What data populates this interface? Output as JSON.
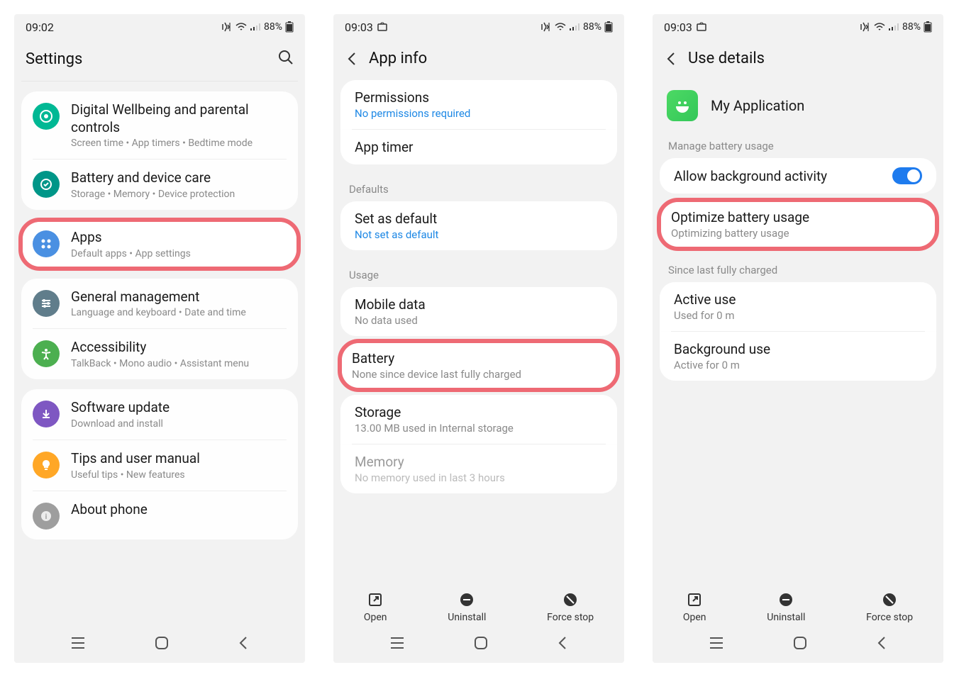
{
  "status": {
    "time1": "09:02",
    "time2": "09:03",
    "battery": "88%"
  },
  "screen1": {
    "title": "Settings",
    "items": {
      "wellbeing": {
        "title": "Digital Wellbeing and parental controls",
        "sub": "Screen time  •  App timers  •  Bedtime mode"
      },
      "battery": {
        "title": "Battery and device care",
        "sub": "Storage  •  Memory  •  Device protection"
      },
      "apps": {
        "title": "Apps",
        "sub": "Default apps  •  App settings"
      },
      "general": {
        "title": "General management",
        "sub": "Language and keyboard  •  Date and time"
      },
      "accessibility": {
        "title": "Accessibility",
        "sub": "TalkBack  •  Mono audio  •  Assistant menu"
      },
      "update": {
        "title": "Software update",
        "sub": "Download and install"
      },
      "tips": {
        "title": "Tips and user manual",
        "sub": "Useful tips  •  New features"
      },
      "about": {
        "title": "About phone"
      }
    }
  },
  "screen2": {
    "title": "App info",
    "permissions": {
      "title": "Permissions",
      "sub": "No permissions required"
    },
    "apptimer": {
      "title": "App timer"
    },
    "defaults_header": "Defaults",
    "setdefault": {
      "title": "Set as default",
      "sub": "Not set as default"
    },
    "usage_header": "Usage",
    "mobiledata": {
      "title": "Mobile data",
      "sub": "No data used"
    },
    "battery": {
      "title": "Battery",
      "sub": "None since device last fully charged"
    },
    "storage": {
      "title": "Storage",
      "sub": "13.00 MB used in Internal storage"
    },
    "memory": {
      "title": "Memory",
      "sub": "No memory used in last 3 hours"
    },
    "actions": {
      "open": "Open",
      "uninstall": "Uninstall",
      "forcestop": "Force stop"
    }
  },
  "screen3": {
    "title": "Use details",
    "app_name": "My Application",
    "manage_header": "Manage battery usage",
    "allow_bg": "Allow background activity",
    "optimize": {
      "title": "Optimize battery usage",
      "sub": "Optimizing battery usage"
    },
    "since_header": "Since last fully charged",
    "active": {
      "title": "Active use",
      "sub": "Used for 0 m"
    },
    "background": {
      "title": "Background use",
      "sub": "Active for 0 m"
    },
    "actions": {
      "open": "Open",
      "uninstall": "Uninstall",
      "forcestop": "Force stop"
    }
  }
}
